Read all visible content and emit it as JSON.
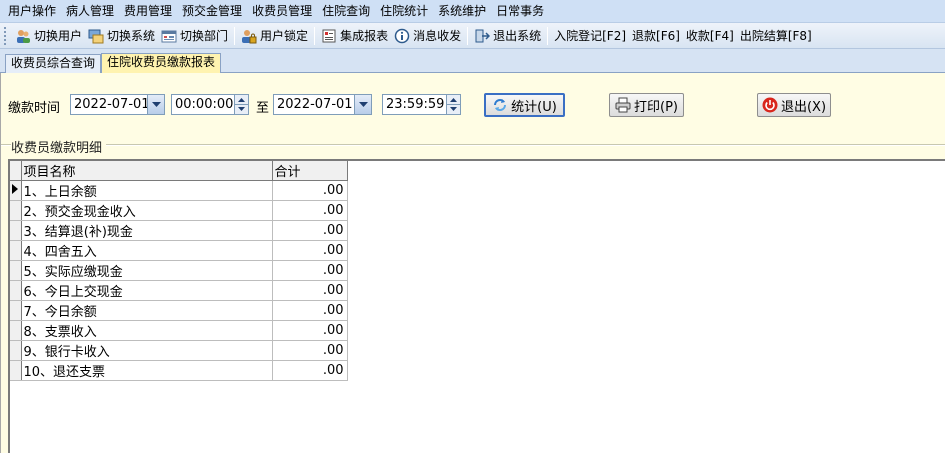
{
  "menu": [
    "用户操作",
    "病人管理",
    "费用管理",
    "预交金管理",
    "收费员管理",
    "住院查询",
    "住院统计",
    "系统维护",
    "日常事务"
  ],
  "toolbar": {
    "switch_user": "切换用户",
    "switch_system": "切换系统",
    "switch_dept": "切换部门",
    "lock_user": "用户锁定",
    "integrated_report": "集成报表",
    "messages": "消息收发",
    "exit_system": "退出系统",
    "admission": "入院登记[F2]",
    "refund": "退款[F6]",
    "collect": "收款[F4]",
    "discharge": "出院结算[F8]"
  },
  "tabs": [
    "收费员综合查询",
    "住院收费员缴款报表"
  ],
  "form": {
    "payment_time_label": "缴款时间",
    "start_date": "2022-07-01",
    "start_time": "00:00:00",
    "to_label": "至",
    "end_date": "2022-07-01",
    "end_time": "23:59:59",
    "stat_button": "统计(U)",
    "print_button": "打印(P)",
    "exit_button": "退出(X)"
  },
  "group_title": "收费员缴款明细",
  "table": {
    "headers": [
      "项目名称",
      "合计"
    ],
    "rows": [
      {
        "name": "1、上日余额",
        "total": ".00"
      },
      {
        "name": "2、预交金现金收入",
        "total": ".00"
      },
      {
        "name": "3、结算退(补)现金",
        "total": ".00"
      },
      {
        "name": "4、四舍五入",
        "total": ".00"
      },
      {
        "name": "5、实际应缴现金",
        "total": ".00"
      },
      {
        "name": "6、今日上交现金",
        "total": ".00"
      },
      {
        "name": "7、今日余额",
        "total": ".00"
      },
      {
        "name": "8、支票收入",
        "total": ".00"
      },
      {
        "name": "9、银行卡收入",
        "total": ".00"
      },
      {
        "name": "10、退还支票",
        "total": ".00"
      }
    ]
  },
  "colors": {
    "menubar": "#cfe0f5",
    "panel": "#fffde4",
    "active_tab": "#fff3b0",
    "exit_icon": "#d9261c"
  }
}
